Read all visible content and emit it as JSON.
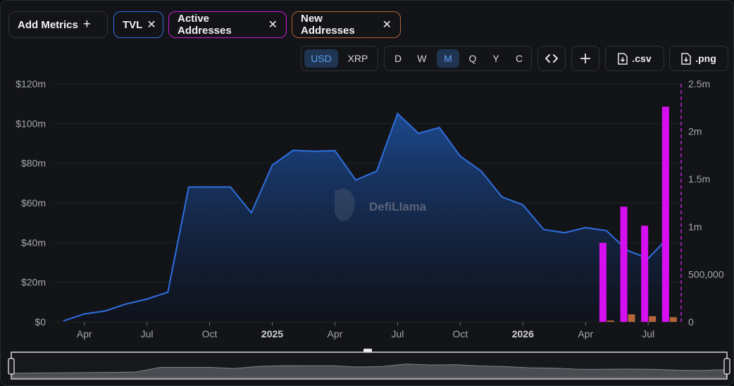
{
  "toolbar": {
    "add_metrics": "Add Metrics",
    "metrics": [
      {
        "label": "TVL",
        "color": "#2f6fe0"
      },
      {
        "label": "Active Addresses",
        "color": "#c51fd8"
      },
      {
        "label": "New Addresses",
        "color": "#b5643a"
      }
    ],
    "currency": {
      "options": [
        "USD",
        "XRP"
      ],
      "selected": "USD"
    },
    "intervals": {
      "options": [
        "D",
        "W",
        "M",
        "Q",
        "Y",
        "C"
      ],
      "selected": "M"
    },
    "embed_icon": "code-brackets-icon",
    "add_icon": "plus-icon",
    "csv_label": ".csv",
    "png_label": ".png"
  },
  "chart_data": {
    "type": "line",
    "watermark": "DefiLlama",
    "x": [
      "2024-03",
      "2024-04",
      "2024-05",
      "2024-06",
      "2024-07",
      "2024-08",
      "2024-09",
      "2024-10",
      "2024-11",
      "2024-12",
      "2025-01",
      "2025-02",
      "2025-03",
      "2025-04",
      "2025-05",
      "2025-06",
      "2025-07",
      "2025-08",
      "2025-09",
      "2025-10",
      "2025-11",
      "2025-12",
      "2026-01",
      "2026-02",
      "2026-03",
      "2026-04",
      "2026-05",
      "2026-06",
      "2026-07",
      "2026-08"
    ],
    "x_ticks": [
      "Apr",
      "Jul",
      "Oct",
      "2025",
      "Apr",
      "Jul",
      "Oct",
      "2026",
      "Apr",
      "Jul"
    ],
    "left_axis": {
      "ticks": [
        "$0",
        "$20m",
        "$40m",
        "$60m",
        "$80m",
        "$100m",
        "$120m"
      ],
      "ylim": [
        0,
        120
      ]
    },
    "right_axis": {
      "ticks": [
        "0",
        "500,000",
        "1m",
        "1.5m",
        "2m",
        "2.5m"
      ],
      "ylim": [
        0,
        2500000
      ]
    },
    "grid": true,
    "series": [
      {
        "name": "TVL",
        "type": "area",
        "axis": "left",
        "color": "#2f6fe0",
        "values": [
          0.5,
          4,
          5.5,
          9,
          11.5,
          15,
          68,
          68,
          68,
          55,
          79,
          86.5,
          86,
          86.3,
          71.5,
          76,
          105,
          95,
          98,
          83.5,
          76,
          63,
          59,
          46.5,
          45,
          47.5,
          46,
          36,
          32,
          43
        ]
      },
      {
        "name": "Active Addresses",
        "type": "bar",
        "axis": "right",
        "color": "#d60ff0",
        "values": [
          null,
          null,
          null,
          null,
          null,
          null,
          null,
          null,
          null,
          null,
          null,
          null,
          null,
          null,
          null,
          null,
          null,
          null,
          null,
          null,
          null,
          null,
          null,
          null,
          null,
          null,
          830000,
          1210000,
          1010000,
          2260000
        ]
      },
      {
        "name": "New Addresses",
        "type": "bar",
        "axis": "right",
        "color": "#b5643a",
        "values": [
          null,
          null,
          null,
          null,
          null,
          null,
          null,
          null,
          null,
          null,
          null,
          null,
          null,
          null,
          null,
          null,
          null,
          null,
          null,
          null,
          null,
          null,
          null,
          null,
          null,
          null,
          8000,
          80000,
          60000,
          50000
        ]
      }
    ],
    "brush": {
      "start": 0,
      "end": 1
    }
  }
}
